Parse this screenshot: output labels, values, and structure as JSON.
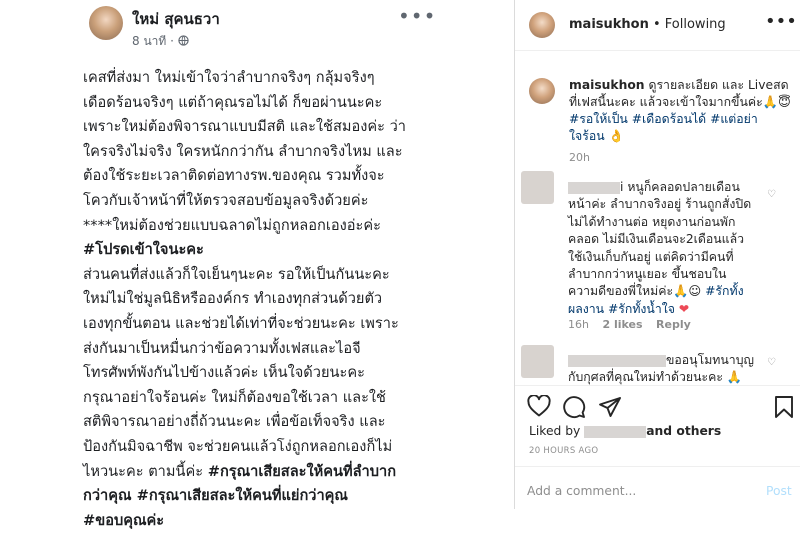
{
  "facebook": {
    "author": "ใหม่ สุคนธวา",
    "time": "8 นาที · ",
    "more": "•••",
    "lines": [
      {
        "text": "เคสที่ส่งมา ใหม่เข้าใจว่าลำบากจริงๆ กลุ้มจริงๆ",
        "bold": false
      },
      {
        "text": "เดือดร้อนจริงๆ แต่ถ้าคุณรอไม่ได้ ก็ขอผ่านนะคะ",
        "bold": false
      },
      {
        "text": "เพราะใหม่ต้องพิจารณาแบบมีสติ และใช้สมองค่ะ ว่า",
        "bold": false
      },
      {
        "text": "ใครจริงไม่จริง ใครหนักกว่ากัน ลำบากจริงไหม และ",
        "bold": false
      },
      {
        "text": "ต้องใช้ระยะเวลาติดต่อทางรพ.ของคุณ รวมทั้งจะ",
        "bold": false
      },
      {
        "text": "โควกับเจ้าหน้าที่ให้ตรวจสอบข้อมูลจริงด้วยค่ะ",
        "bold": false
      },
      {
        "text": "****ใหม่ต้องช่วยแบบฉลาดไม่ถูกหลอกเองอ่ะค่ะ",
        "bold": false
      },
      {
        "text": "#โปรดเข้าใจนะคะ",
        "bold": true
      },
      {
        "text": "ส่วนคนที่ส่งแล้วก็ใจเย็นๆนะคะ รอให้เป็นกันนะคะ",
        "bold": false
      },
      {
        "text": "ใหม่ไม่ใช่มูลนิธิหรือองค์กร ทำเองทุกส่วนด้วยตัว",
        "bold": false
      },
      {
        "text": "เองทุกขั้นตอน และช่วยได้เท่าที่จะช่วยนะคะ เพราะ",
        "bold": false
      },
      {
        "text": "ส่งกันมาเป็นหมื่นกว่าข้อความทั้งเฟสและไอจี",
        "bold": false
      },
      {
        "text": "โทรศัพท์พังกันไปข้างแล้วค่ะ เห็นใจด้วยนะคะ",
        "bold": false
      },
      {
        "text": "กรุณาอย่าใจร้อนค่ะ ใหม่ก็ต้องขอใช้เวลา และใช้",
        "bold": false
      },
      {
        "text": "สติพิจารณาอย่างถี่ถ้วนนะคะ เพื่อข้อเท็จจริง และ",
        "bold": false
      },
      {
        "text": "ป้องกันมิจฉาชีพ จะช่วยคนแล้วโง่ถูกหลอกเองก็ไม่",
        "bold": false
      }
    ],
    "line17_normal": "ไหวนะคะ ตามนี้ค่ะ ",
    "line17_bold": "#กรุณาเสียสละให้คนที่ลำบาก",
    "line18": "กว่าคุณ #กรุณาเสียสละให้คนที่แย่กว่าคุณ",
    "line19": "#ขอบคุณค่ะ"
  },
  "instagram": {
    "username": "maisukhon",
    "following": " • Following",
    "more": "•••",
    "caption_user": "maisukhon",
    "caption_text": " ดูรายละเอียด และ Liveสดที่เฟสนี้นะคะ แล้วจะเข้าใจมากขึ้นค่ะ🙏😇 ",
    "caption_tags": "#รอให้เป็น #เดือดร้อนได้ #แต่อย่าใจร้อน",
    "caption_emoji": " 👌",
    "caption_time": "20h",
    "comment1_text_a": "i หนูก็คลอดปลายเดือนหน้าค่ะ ลำบากจริงอยู่ ร้านถูกสั่งปิดไม่ได้ทำงานต่อ หยุดงานก่อนพักคลอด ไม่มีเงินเดือนจะ2เดือนแล้ว ใช้เงินเก็บกันอยู่ แต่คิดว่ามีคนที่ลำบากกว่าหนูเยอะ ขึ้นชอบในความดีของพี่ใหม่ค่ะ🙏☺ ",
    "comment1_tags": "#รักทั้งผลงาน #รักทั้งน้ำใจ",
    "comment1_heart": " ❤",
    "comment1_time": "16h",
    "comment1_likes": "2 likes",
    "comment1_reply": "Reply",
    "comment2_text": "ขออนุโมทนาบุญกับกุศลที่คุณใหม่ทำด้วยนะคะ 🙏",
    "liked_prefix": "Liked by ",
    "liked_suffix": "and others",
    "posted": "20 HOURS AGO",
    "add_comment": "Add a comment...",
    "post_label": "Post",
    "icons": [
      "heart-icon",
      "comment-icon",
      "share-icon",
      "bookmark-icon"
    ]
  }
}
